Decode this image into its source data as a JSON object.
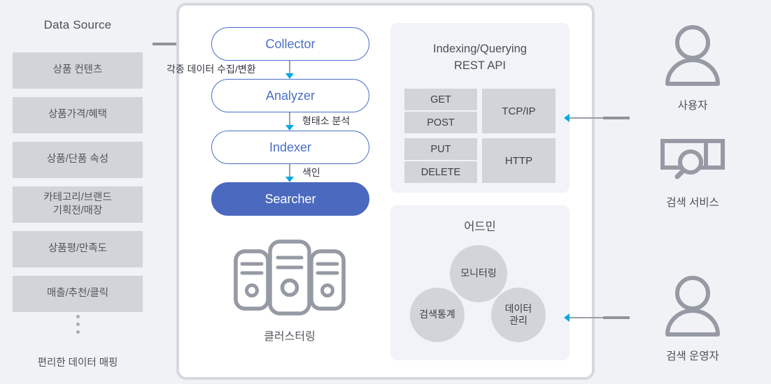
{
  "data_source": {
    "title": "Data Source",
    "items": [
      {
        "label": "상품 컨텐츠"
      },
      {
        "label": "상품가격/혜택"
      },
      {
        "label": "상품/단품 속성"
      },
      {
        "label": "카테고리/브랜드\n기획전/매장"
      },
      {
        "label": "상품평/만족도"
      },
      {
        "label": "매출/추천/클릭"
      }
    ],
    "ellipsis_icon": "vertical-dots-icon",
    "footnote": "편리한 데이터 매핑"
  },
  "pipeline": {
    "stages": [
      {
        "label": "Collector",
        "style": "outline"
      },
      {
        "label": "Analyzer",
        "style": "outline"
      },
      {
        "label": "Indexer",
        "style": "outline"
      },
      {
        "label": "Searcher",
        "style": "filled"
      }
    ],
    "captions": {
      "collect": "각종 데이터 수집/변환",
      "morphological": "형태소 분석",
      "indexing": "색인"
    }
  },
  "clustering": {
    "icon": "server-stack-icon",
    "label": "클러스터링"
  },
  "rest_api": {
    "title_line1": "Indexing/Querying",
    "title_line2": "REST API",
    "method_groups": [
      {
        "methods": [
          "GET",
          "POST"
        ]
      },
      {
        "methods": [
          "PUT",
          "DELETE"
        ]
      }
    ],
    "protocols": [
      "TCP/IP",
      "HTTP"
    ]
  },
  "admin": {
    "title": "어드민",
    "circles": [
      {
        "label": "모니터링"
      },
      {
        "label": "검색통계"
      },
      {
        "label": "데이터\n관리"
      }
    ]
  },
  "actors": [
    {
      "icon": "person-icon",
      "label": "사용자"
    },
    {
      "icon": "search-box-icon",
      "label": "검색 서비스"
    },
    {
      "icon": "person-icon",
      "label": "검색 운영자"
    }
  ],
  "colors": {
    "page_background": "#f1f2f6",
    "panel_background": "#ffffff",
    "panel_border": "#d5d8dd",
    "subpanel_background": "#f1f3f8",
    "accent_blue": "#4a6fc4",
    "searcher_fill": "#4a69bf",
    "arrow_head": "#00a9e0",
    "connector_line": "#9a9ea6",
    "connector_stub": "#8f939a",
    "box_gray": "#d2d4d9",
    "icon_gray": "#969aa4",
    "text_dark": "#4b4f58"
  }
}
